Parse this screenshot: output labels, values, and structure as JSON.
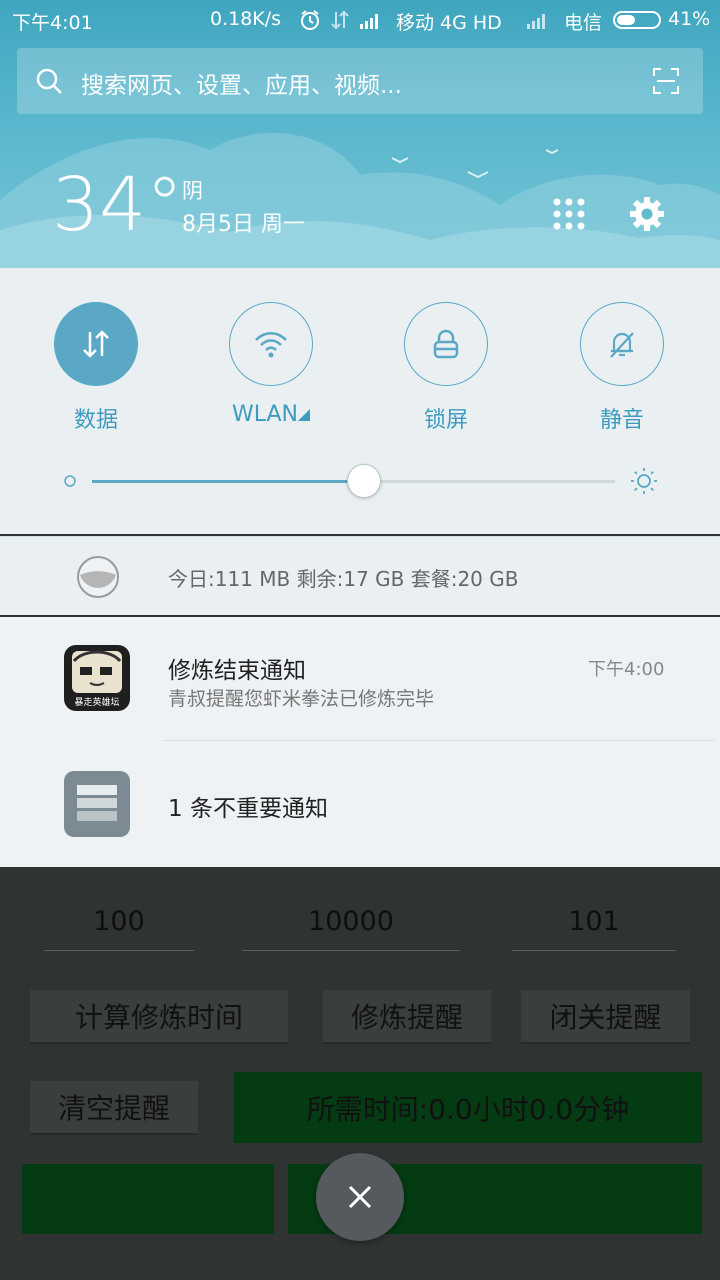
{
  "status_bar": {
    "time": "下午4:01",
    "net_speed": "0.18K/s",
    "carrier1": "移动 4G HD",
    "carrier2": "电信",
    "battery": "41%",
    "icons": [
      "alarm-icon",
      "data-arrows-icon",
      "signal-icon",
      "battery-icon"
    ]
  },
  "search": {
    "placeholder": "搜索网页、设置、应用、视频..."
  },
  "weather": {
    "temperature": "34°",
    "condition": "阴",
    "date": "8月5日 周一"
  },
  "quick_settings": {
    "toggles": [
      {
        "label": "数据",
        "icon": "data-arrows-icon",
        "active": true
      },
      {
        "label": "WLAN",
        "icon": "wifi-icon",
        "active": false
      },
      {
        "label": "锁屏",
        "icon": "lock-icon",
        "active": false
      },
      {
        "label": "静音",
        "icon": "bell-off-icon",
        "active": false
      }
    ],
    "brightness_level": 0.52
  },
  "data_usage": {
    "text": "今日:111 MB   剩余:17 GB   套餐:20 GB"
  },
  "notifications": [
    {
      "app_label": "暴走英雄坛",
      "title": "修炼结束通知",
      "body": "青叔提醒您虾米拳法已修炼完毕",
      "time": "下午4:00"
    },
    {
      "title": "1 条不重要通知"
    }
  ],
  "app": {
    "fields": [
      "100",
      "10000",
      "101"
    ],
    "buttons": [
      "计算修炼时间",
      "修炼提醒",
      "闭关提醒",
      "清空提醒"
    ],
    "result": "所需时间:0.0小时0.0分钟"
  },
  "colors": {
    "accent": "#5aa8c6",
    "header_top": "#3fa6bf",
    "panel_bg": "#eaf0f2",
    "result_green": "#043b12"
  }
}
